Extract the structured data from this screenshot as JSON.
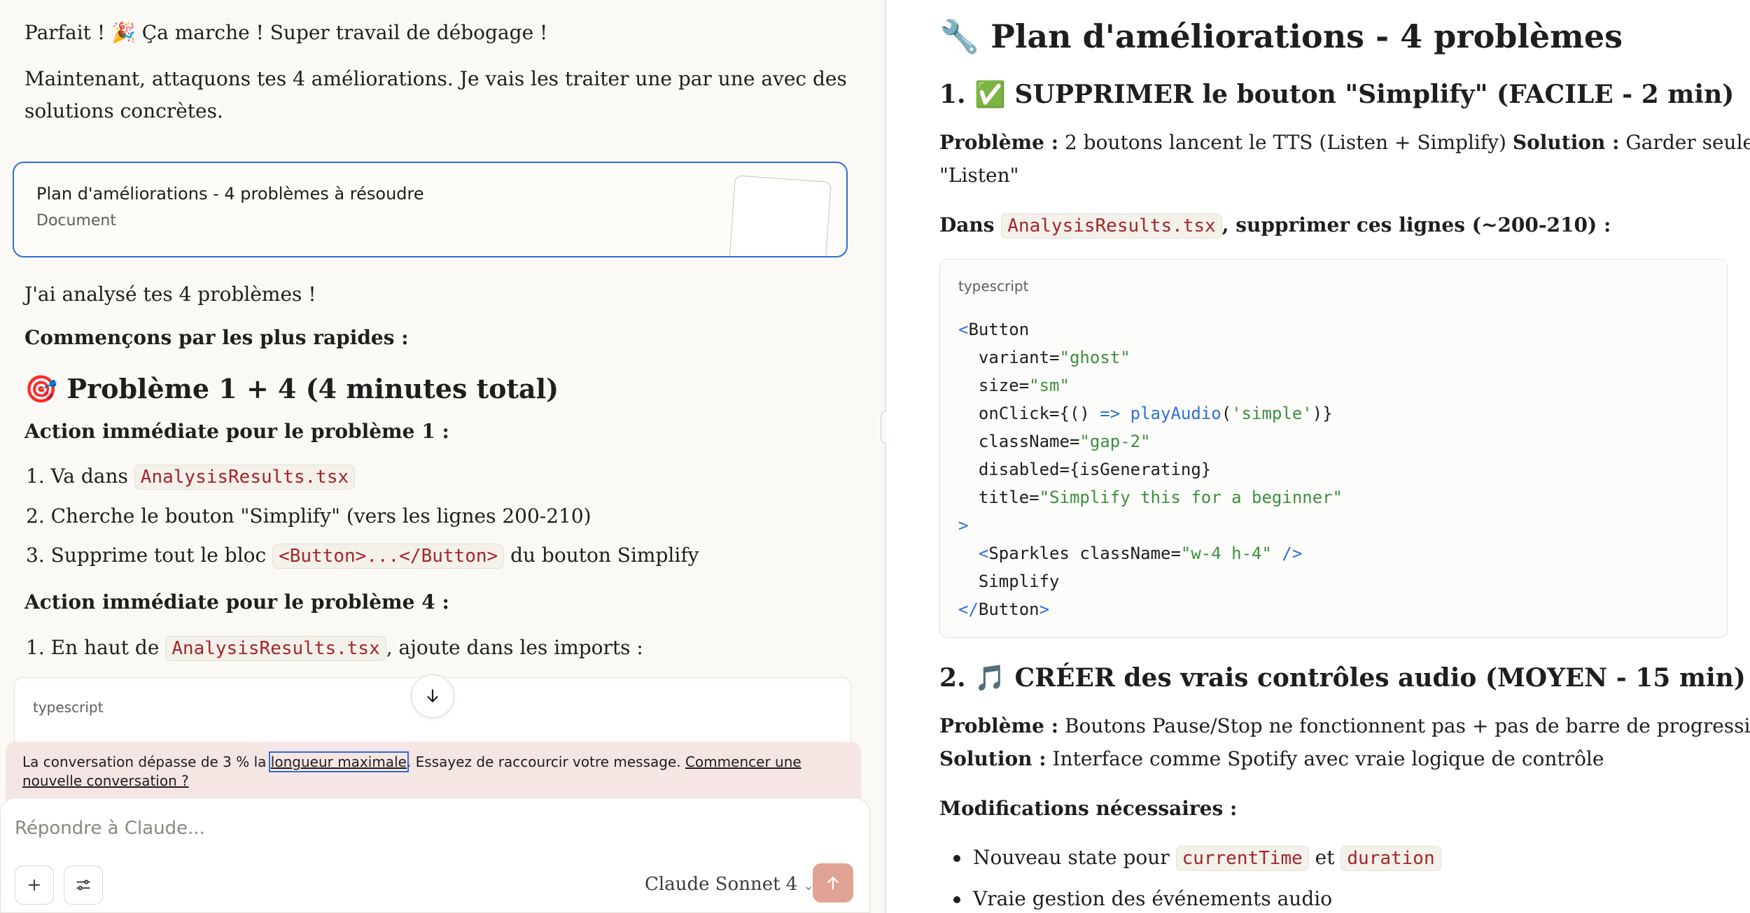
{
  "chat": {
    "intro1": "Parfait ! 🎉 Ça marche ! Super travail de débogage !",
    "intro2a": "Maintenant, attaquons tes 4 améliorations. Je vais les traiter une par une avec des",
    "intro2b": "solutions concrètes.",
    "artifact": {
      "title": "Plan d'améliorations - 4 problèmes à résoudre",
      "type": "Document"
    },
    "analyzed": "J'ai analysé tes 4 problèmes !",
    "start": "Commençons par les plus rapides :",
    "problem_heading": "🎯 Problème 1 + 4 (4 minutes total)",
    "action1": "Action immédiate pour le problème 1 :",
    "steps1": [
      {
        "num": "1.",
        "pre": "Va dans",
        "code": "AnalysisResults.tsx",
        "post": ""
      },
      {
        "num": "2.",
        "pre": "Cherche le bouton \"Simplify\" (vers les lignes 200-210)",
        "code": "",
        "post": ""
      },
      {
        "num": "3.",
        "pre": "Supprime tout le bloc",
        "code": "<Button>...</Button>",
        "post": "du bouton Simplify"
      }
    ],
    "action4": "Action immédiate pour le problème 4 :",
    "steps4": [
      {
        "num": "1.",
        "pre": "En haut de",
        "code": "AnalysisResults.tsx",
        "post": ", ajoute dans les imports :"
      }
    ],
    "code_lang": "typescript"
  },
  "warning": {
    "text1": "La conversation dépasse de 3 % la",
    "link1": "longueur maximale",
    "text2": ". Essayez de raccourcir votre message.",
    "link2": "Commencer une nouvelle conversation ?"
  },
  "composer": {
    "placeholder": "Répondre à Claude...",
    "model": "Claude Sonnet 4"
  },
  "doc": {
    "title": "🔧 Plan d'améliorations - 4 problèmes",
    "s1_heading": "1. ✅ SUPPRIMER le bouton \"Simplify\" (FACILE - 2 min)",
    "s1_problem_label": "Problème :",
    "s1_problem": "2 boutons lancent le TTS (Listen + Simplify)",
    "s1_solution_label": "Solution :",
    "s1_solution_a": "Garder seulement",
    "s1_solution_b": "\"Listen\"",
    "s1_dans": "Dans",
    "s1_file": "AnalysisResults.tsx",
    "s1_delete": ", supprimer ces lignes (~200-210) :",
    "code_lang": "typescript",
    "s2_heading": "2. 🎵 CRÉER des vrais contrôles audio (MOYEN - 15 min)",
    "s2_problem_label": "Problème :",
    "s2_problem": "Boutons Pause/Stop ne fonctionnent pas + pas de barre de progression",
    "s2_solution_label": "Solution :",
    "s2_solution": "Interface comme Spotify avec vraie logique de contrôle",
    "s2_mods": "Modifications nécessaires :",
    "bullet1_pre": "Nouveau state pour",
    "bullet1_code1": "currentTime",
    "bullet1_mid": "et",
    "bullet1_code2": "duration",
    "bullet2": "Vraie gestion des événements audio"
  }
}
